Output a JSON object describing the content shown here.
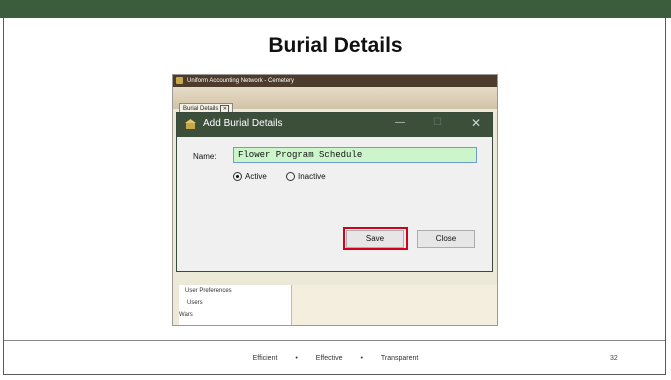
{
  "slide": {
    "title": "Burial Details",
    "page_number": "32"
  },
  "footer": {
    "items": [
      "Efficient",
      "•",
      "Effective",
      "•",
      "Transparent"
    ]
  },
  "app": {
    "window_title": "Uniform Accounting Network - Cemetery",
    "banner_text": "Uniform Accounting Network",
    "tab_label": "Burial Details",
    "tree_items": [
      "User Preferences",
      "Users",
      "Wars"
    ]
  },
  "dialog": {
    "title": "Add Burial Details",
    "name_label": "Name:",
    "name_value": "Flower Program Schedule",
    "radio_active": "Active",
    "radio_inactive": "Inactive",
    "save_label": "Save",
    "close_label": "Close"
  },
  "colors": {
    "titlebar": "#3b4f3b",
    "input_bg": "#ccf5cc",
    "highlight": "#d4001a",
    "topbar": "#3b5d3b"
  }
}
